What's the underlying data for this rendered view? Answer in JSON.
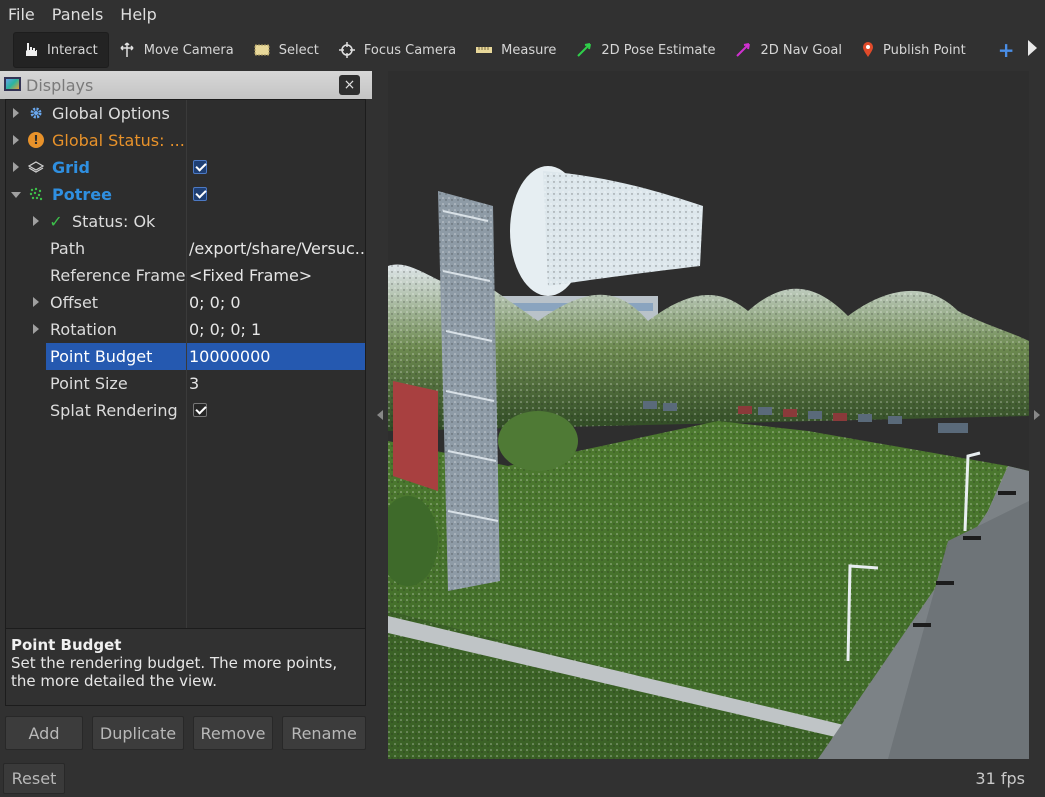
{
  "menubar": {
    "items": [
      "File",
      "Panels",
      "Help"
    ]
  },
  "toolbar": {
    "tools": [
      {
        "label": "Interact",
        "icon": "hand-pointer-icon"
      },
      {
        "label": "Move Camera",
        "icon": "move-camera-icon"
      },
      {
        "label": "Select",
        "icon": "select-icon"
      },
      {
        "label": "Focus Camera",
        "icon": "focus-camera-icon"
      },
      {
        "label": "Measure",
        "icon": "measure-icon"
      },
      {
        "label": "2D Pose Estimate",
        "icon": "pose-arrow-icon"
      },
      {
        "label": "2D Nav Goal",
        "icon": "nav-goal-arrow-icon"
      },
      {
        "label": "Publish Point",
        "icon": "map-pin-icon"
      }
    ],
    "add_label": "+"
  },
  "displays": {
    "title": "Displays",
    "close_label": "×",
    "rows": {
      "global_options": "Global Options",
      "global_status": "Global Status: ...",
      "grid": "Grid",
      "potree": "Potree",
      "status": "Status: Ok",
      "path": {
        "name": "Path",
        "value": "/export/share/Versuc..."
      },
      "reference_frame": {
        "name": "Reference Frame",
        "value": "<Fixed Frame>"
      },
      "offset": {
        "name": "Offset",
        "value": "0; 0; 0"
      },
      "rotation": {
        "name": "Rotation",
        "value": "0; 0; 0; 1"
      },
      "point_budget": {
        "name": "Point Budget",
        "value": "10000000"
      },
      "point_size": {
        "name": "Point Size",
        "value": "3"
      },
      "splat_rendering": {
        "name": "Splat Rendering"
      }
    },
    "description": {
      "title": "Point Budget",
      "text": "Set the rendering budget. The more points, the more detailed the view."
    },
    "buttons": {
      "add": "Add",
      "duplicate": "Duplicate",
      "remove": "Remove",
      "rename": "Rename"
    }
  },
  "statusbar": {
    "reset": "Reset",
    "fps": "31 fps"
  },
  "colors": {
    "selection": "#2559b0",
    "accent_blue": "#2f8fe0",
    "warning_orange": "#e8922a"
  }
}
